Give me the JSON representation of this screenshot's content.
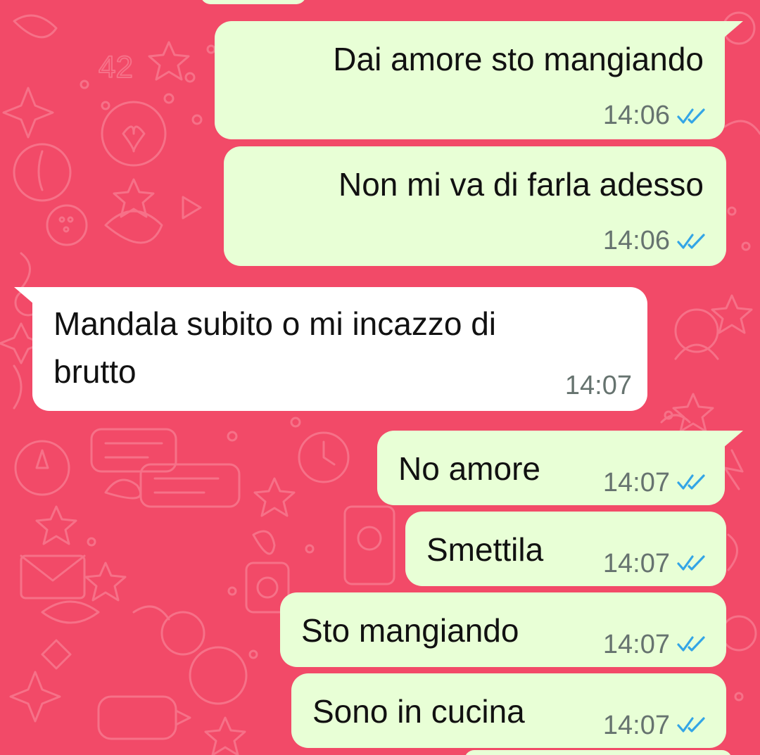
{
  "colors": {
    "wallpaper": "#F24A68",
    "outgoing_bubble": "#E8FFD6",
    "incoming_bubble": "#FFFFFF",
    "read_ticks": "#33A5E6",
    "timestamp": "#66736F"
  },
  "messages": [
    {
      "direction": "outgoing",
      "text": "Dai amore sto mangiando",
      "time": "14:06",
      "status_icon": "double-check-read-icon"
    },
    {
      "direction": "outgoing",
      "text": "Non mi va di farla adesso",
      "time": "14:06",
      "status_icon": "double-check-read-icon"
    },
    {
      "direction": "incoming",
      "lines": [
        "Mandala subito o mi incazzo di",
        "brutto"
      ],
      "time": "14:07"
    },
    {
      "direction": "outgoing",
      "text": "No amore",
      "time": "14:07",
      "status_icon": "double-check-read-icon"
    },
    {
      "direction": "outgoing",
      "text": "Smettila",
      "time": "14:07",
      "status_icon": "double-check-read-icon"
    },
    {
      "direction": "outgoing",
      "text": "Sto mangiando",
      "time": "14:07",
      "status_icon": "double-check-read-icon"
    },
    {
      "direction": "outgoing",
      "text": "Sono in cucina",
      "time": "14:07",
      "status_icon": "double-check-read-icon"
    }
  ]
}
